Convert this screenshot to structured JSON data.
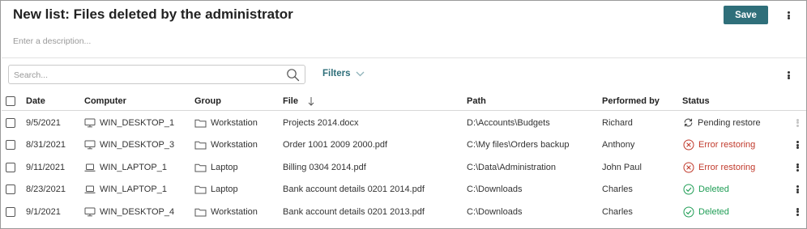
{
  "header": {
    "title": "New list: Files deleted by the administrator",
    "save_label": "Save",
    "description_placeholder": "Enter a description..."
  },
  "toolbar": {
    "search_placeholder": "Search...",
    "filters_label": "Filters"
  },
  "table": {
    "columns": {
      "date": "Date",
      "computer": "Computer",
      "group": "Group",
      "file": "File",
      "path": "Path",
      "performed_by": "Performed by",
      "status": "Status"
    },
    "sort": {
      "column": "File",
      "direction": "descending"
    },
    "rows": [
      {
        "date": "9/5/2021",
        "computer": "WIN_DESKTOP_1",
        "group": "Workstation",
        "file": "Projects 2014.docx",
        "path": "D:\\Accounts\\Budgets",
        "performed_by": "Richard",
        "status": "Pending restore",
        "status_type": "pending",
        "status_icon": "sync-icon"
      },
      {
        "date": "8/31/2021",
        "computer": "WIN_DESKTOP_3",
        "group": "Workstation",
        "file": "Order 1001 2009 2000.pdf",
        "path": "C:\\My files\\Orders backup",
        "performed_by": "Anthony",
        "status": "Error restoring",
        "status_type": "error",
        "status_icon": "error-circle-icon"
      },
      {
        "date": "9/11/2021",
        "computer": "WIN_LAPTOP_1",
        "group": "Laptop",
        "file": "Billing 0304 2014.pdf",
        "path": "C:\\Data\\Administration",
        "performed_by": "John Paul",
        "status": "Error restoring",
        "status_type": "error",
        "status_icon": "error-circle-icon"
      },
      {
        "date": "8/23/2021",
        "computer": "WIN_LAPTOP_1",
        "group": "Laptop",
        "file": "Bank account details 0201 2014.pdf",
        "path": "C:\\Downloads",
        "performed_by": "Charles",
        "status": "Deleted",
        "status_type": "deleted",
        "status_icon": "check-circle-icon"
      },
      {
        "date": "9/1/2021",
        "computer": "WIN_DESKTOP_4",
        "group": "Workstation",
        "file": "Bank account details 0201 2013.pdf",
        "path": "C:\\Downloads",
        "performed_by": "Charles",
        "status": "Deleted",
        "status_type": "deleted",
        "status_icon": "check-circle-icon"
      }
    ]
  },
  "colors": {
    "accent": "#2f6f7a",
    "error": "#c0392b",
    "success": "#1f9d55",
    "pending": "#333333"
  }
}
